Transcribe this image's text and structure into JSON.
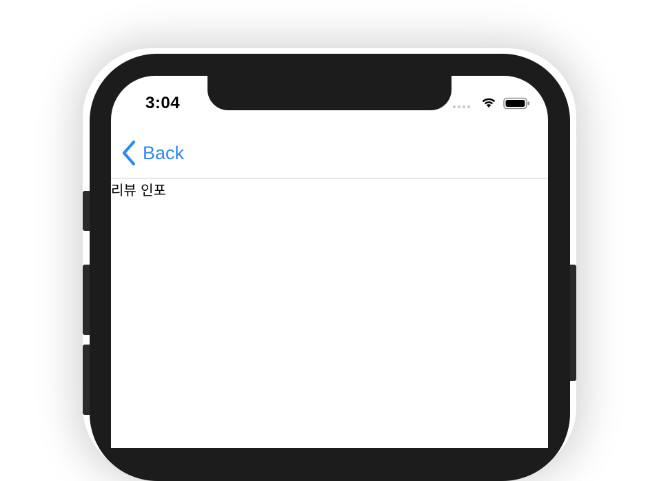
{
  "status_bar": {
    "time": "3:04",
    "icons": [
      "cellular-signal-icon",
      "wifi-icon",
      "battery-icon"
    ]
  },
  "navbar": {
    "back_label": "Back",
    "back_icon": "chevron-left-icon",
    "accent_color": "#2f86f6"
  },
  "content": {
    "text": "리뷰 인포"
  }
}
